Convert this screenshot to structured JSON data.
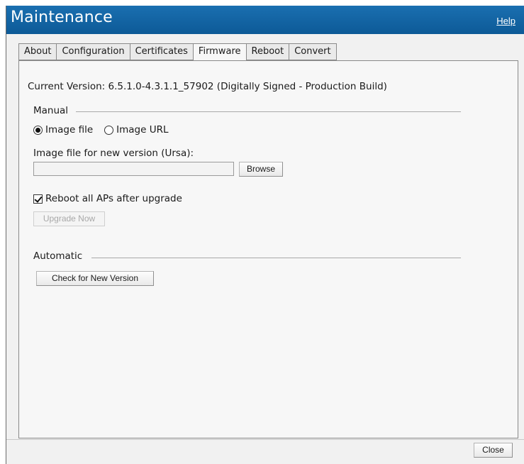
{
  "window": {
    "title": "Maintenance",
    "help_label": "Help"
  },
  "tabs": [
    {
      "label": "About",
      "active": false
    },
    {
      "label": "Configuration",
      "active": false
    },
    {
      "label": "Certificates",
      "active": false
    },
    {
      "label": "Firmware",
      "active": true
    },
    {
      "label": "Reboot",
      "active": false
    },
    {
      "label": "Convert",
      "active": false
    }
  ],
  "firmware": {
    "current_version": "Current Version: 6.5.1.0-4.3.1.1_57902 (Digitally Signed - Production Build)",
    "manual": {
      "legend": "Manual",
      "radio_image_file": {
        "label": "Image file",
        "checked": true
      },
      "radio_image_url": {
        "label": "Image URL",
        "checked": false
      },
      "file_label": "Image file for new version (Ursa):",
      "file_value": "",
      "browse_label": "Browse",
      "reboot_checkbox": {
        "label": "Reboot all APs after upgrade",
        "checked": true
      },
      "upgrade_label": "Upgrade Now"
    },
    "automatic": {
      "legend": "Automatic",
      "check_label": "Check for New Version"
    }
  },
  "footer": {
    "close_label": "Close"
  },
  "colors": {
    "titlebar": "#0d5a97",
    "panel": "#f7f7f7",
    "background": "#f1f1f1"
  }
}
